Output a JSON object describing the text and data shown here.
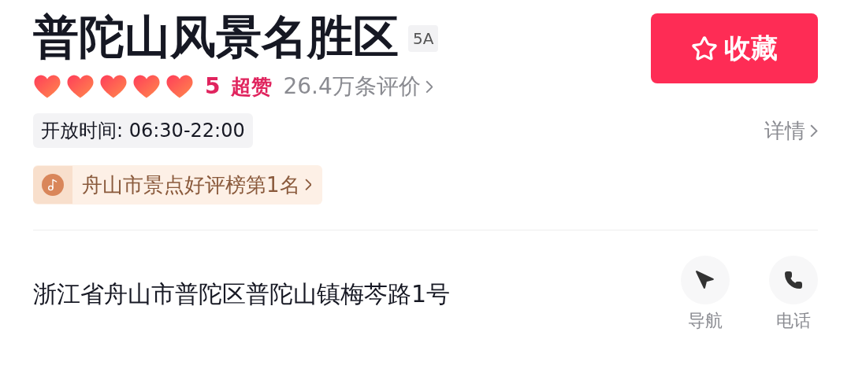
{
  "title": "普陀山风景名胜区",
  "grade_badge": "5A",
  "favorite_button": {
    "label": "收藏"
  },
  "rating": {
    "stars": 5,
    "score": "5",
    "verdict": "超赞",
    "reviews": "26.4万条评价"
  },
  "hours": "开放时间: 06:30-22:00",
  "details": "详情",
  "ranking": "舟山市景点好评榜第1名",
  "address": "浙江省舟山市普陀区普陀山镇梅芩路1号",
  "actions": [
    {
      "label": "导航",
      "kind": "navigate"
    },
    {
      "label": "电话",
      "kind": "phone"
    }
  ]
}
